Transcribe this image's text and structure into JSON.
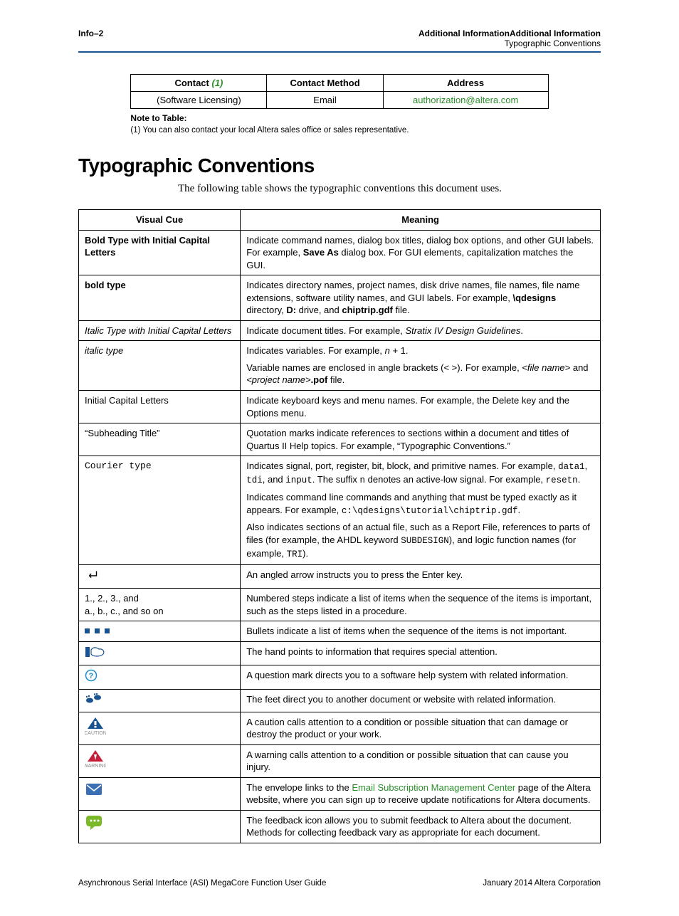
{
  "header": {
    "left": "Info–2",
    "right_title": "Additional InformationAdditional Information",
    "right_sub": "Typographic Conventions"
  },
  "contact_table": {
    "headers": {
      "c1": "Contact",
      "c1_ref": "(1)",
      "c2": "Contact Method",
      "c3": "Address"
    },
    "row": {
      "c1": "(Software Licensing)",
      "c2": "Email",
      "c3": "authorization@altera.com"
    }
  },
  "note": {
    "title": "Note to Table:",
    "item": "(1)  You can also contact your local Altera sales office or sales representative."
  },
  "section_title": "Typographic Conventions",
  "intro": "The following table shows the typographic conventions this document uses.",
  "conv": {
    "h1": "Visual Cue",
    "h2": "Meaning",
    "rows": {
      "r1": {
        "cue": "Bold Type with Initial Capital Letters",
        "m_pre": "Indicate command names, dialog box titles, dialog box options, and other GUI labels. For example, ",
        "m_bold": "Save As",
        "m_post": " dialog box. For GUI elements, capitalization matches the GUI."
      },
      "r2": {
        "cue": "bold type",
        "m_pre": "Indicates directory names, project names, disk drive names, file names, file name extensions, software utility names, and GUI labels. For example, ",
        "m_b1": "\\qdesigns",
        "m_mid1": " directory, ",
        "m_b2": "D:",
        "m_mid2": " drive, and ",
        "m_b3": "chiptrip.gdf",
        "m_post": " file."
      },
      "r3": {
        "cue": "Italic Type with Initial Capital Letters",
        "m_pre": "Indicate document titles. For example, ",
        "m_i": "Stratix IV Design Guidelines",
        "m_post": "."
      },
      "r4": {
        "cue": "italic type",
        "p1_pre": "Indicates variables. For example, ",
        "p1_i": "n",
        "p1_post": " + 1.",
        "p2_pre": "Variable names are enclosed in angle brackets (< >). For example, ",
        "p2_i1": "<file name>",
        "p2_mid": " and ",
        "p2_i2": "<project name>",
        "p2_b": ".pof",
        "p2_post": " file."
      },
      "r5": {
        "cue": "Initial Capital Letters",
        "m": "Indicate keyboard keys and menu names. For example, the Delete key and the Options menu."
      },
      "r6": {
        "cue": "“Subheading Title”",
        "m": "Quotation marks indicate references to sections within a document and titles of Quartus II Help topics. For example, “Typographic Conventions.”"
      },
      "r7": {
        "cue": "Courier type",
        "p1_pre": "Indicates signal, port, register, bit, block, and primitive names. For example, ",
        "p1_c1": "data1",
        "p1_mid1": ", ",
        "p1_c2": "tdi",
        "p1_mid2": ", and ",
        "p1_c3": "input",
        "p1_mid3": ". The suffix ",
        "p1_c4": "n",
        "p1_mid4": " denotes an active-low signal. For example, ",
        "p1_c5": "resetn",
        "p1_post": ".",
        "p2_pre": "Indicates command line commands and anything that must be typed exactly as it appears. For example, ",
        "p2_c": "c:\\qdesigns\\tutorial\\chiptrip.gdf",
        "p2_post": ".",
        "p3_pre": "Also indicates sections of an actual file, such as a Report File, references to parts of files (for example, the AHDL keyword ",
        "p3_c1": "SUBDESIGN",
        "p3_mid": "), and logic function names (for example, ",
        "p3_c2": "TRI",
        "p3_post": ")."
      },
      "r8": {
        "cue": "↵",
        "m": "An angled arrow instructs you to press the Enter key."
      },
      "r9": {
        "cue1": "1., 2., 3., and",
        "cue2": "a., b., c., and so on",
        "m": "Numbered steps indicate a list of items when the sequence of the items is important, such as the steps listed in a procedure."
      },
      "r10": {
        "m": "Bullets indicate a list of items when the sequence of the items is not important."
      },
      "r11": {
        "m": "The hand points to information that requires special attention."
      },
      "r12": {
        "m": "A question mark directs you to a software help system with related information."
      },
      "r13": {
        "m": "The feet direct you to another document or website with related information."
      },
      "r14": {
        "label": "CAUTION",
        "m": "A caution calls attention to a condition or possible situation that can damage or destroy the product or your work."
      },
      "r15": {
        "label": "WARNING",
        "m": "A warning calls attention to a condition or possible situation that can cause you injury."
      },
      "r16": {
        "m_pre": "The envelope links to the ",
        "m_link": "Email Subscription Management Center",
        "m_post": " page of the Altera website, where you can sign up to receive update notifications for Altera documents."
      },
      "r17": {
        "m": "The feedback icon allows you to submit feedback to Altera about the document. Methods for collecting feedback vary as appropriate for each document."
      }
    }
  },
  "footer": {
    "left": "Asynchronous Serial Interface (ASI) MegaCore Function User Guide",
    "right": "January 2014   Altera Corporation"
  }
}
